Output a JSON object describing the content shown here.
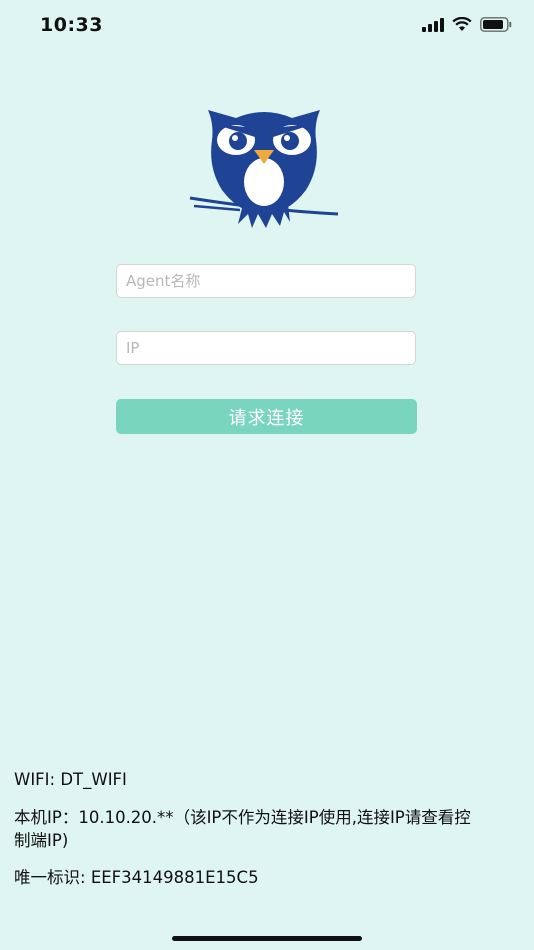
{
  "status_bar": {
    "time": "10:33",
    "signal_icon": "cellular-signal-icon",
    "wifi_icon": "wifi-icon",
    "battery_icon": "battery-icon"
  },
  "logo": {
    "icon": "owl-logo-icon",
    "primary_color": "#1f4496",
    "accent_color": "#f0a93b"
  },
  "form": {
    "agent_name_placeholder": "Agent名称",
    "ip_placeholder": "IP",
    "connect_label": "请求连接",
    "button_color": "#79d5be"
  },
  "info": {
    "wifi_label": "WIFI: ",
    "wifi_value": "DT_WIFI",
    "local_ip_label": "本机IP：",
    "local_ip_value": "10.10.20.**",
    "local_ip_note": "（该IP不作为连接IP使用,连接IP请查看控制端IP)",
    "uid_label": "唯一标识: ",
    "uid_value": "EEF34149881E15C5"
  }
}
